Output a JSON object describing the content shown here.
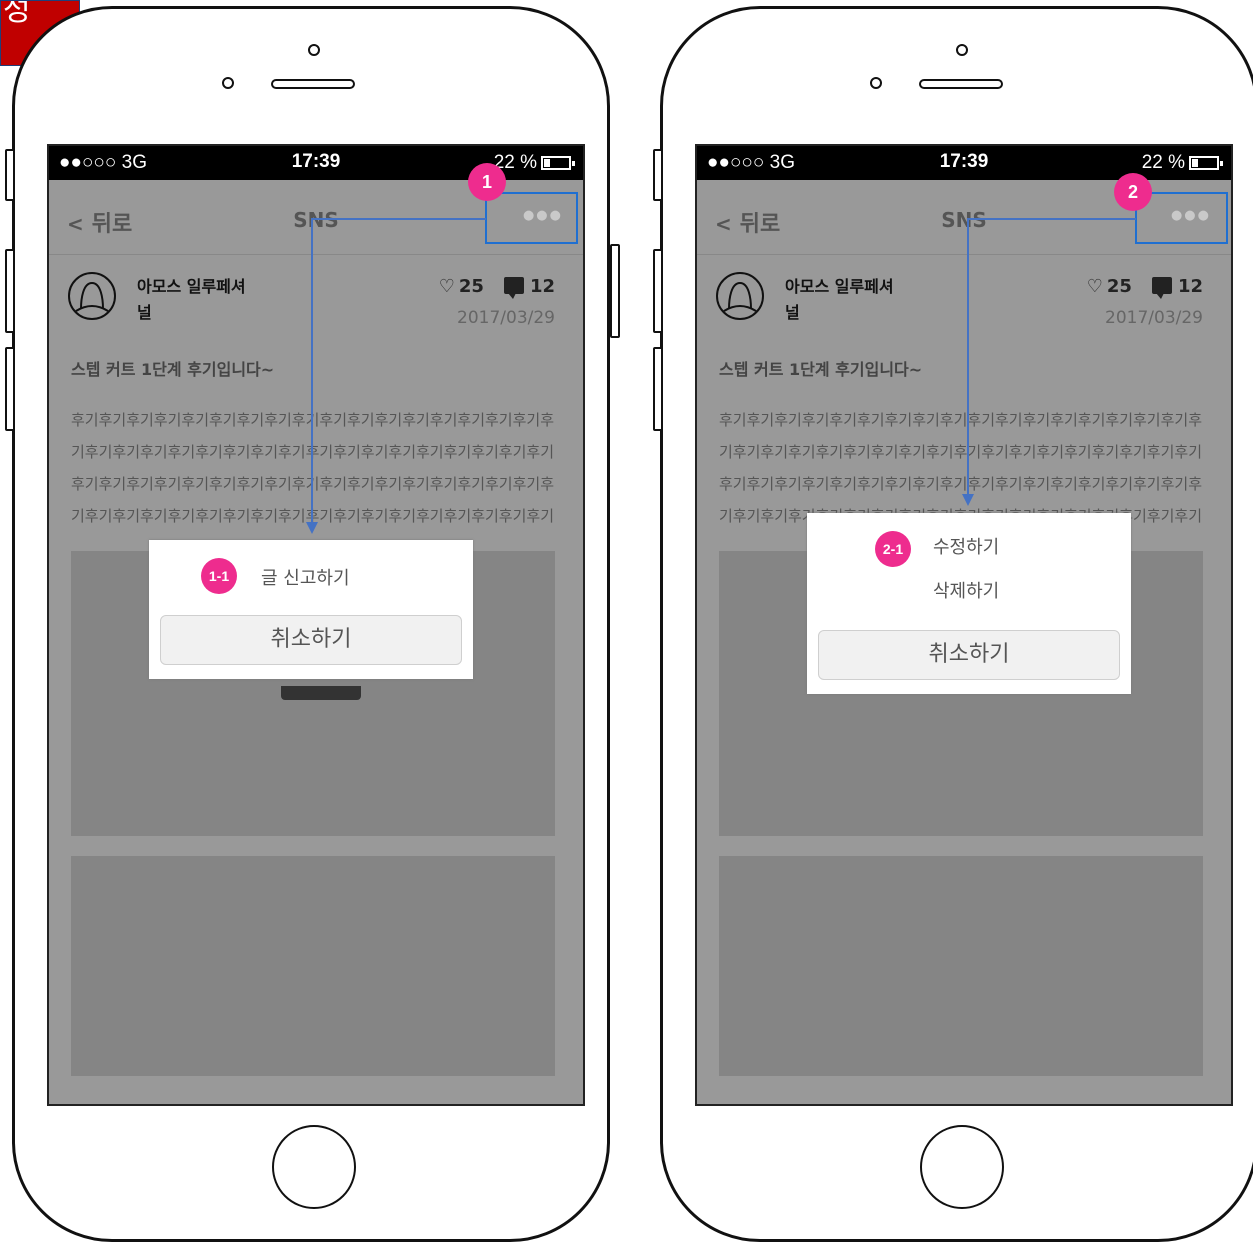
{
  "corner_label": "성",
  "status_bar": {
    "signal": "●●○○○  3G",
    "time": "17:39",
    "battery": "22 %"
  },
  "nav": {
    "back_arrow": "<",
    "back_label": "뒤로",
    "title": "SNS",
    "more_icon": "●●●"
  },
  "post": {
    "username": "아모스 일루페셔널",
    "likes": "25",
    "comments": "12",
    "date": "2017/03/29",
    "title": "스텝 커트 1단계 후기입니다~",
    "body": "후기후기후기후기후기후기후기후기후기후기후기후기후기후기후기후기후기후기후기후기후기후기후기후기후기후기후기후기후기후기후기후기후기후기후기후기후기후기후기후기후기후기후기후기후기후기후기후기후기후기후기후기후기후기후기후기후기후기후기후기후기후기후기후기후기후기후기후기후기후기후기후기"
  },
  "phone_left": {
    "badge": "1",
    "dialog_badge": "1-1",
    "option_report": "글 신고하기",
    "cancel": "취소하기"
  },
  "phone_right": {
    "badge": "2",
    "dialog_badge": "2-1",
    "option_edit": "수정하기",
    "option_delete": "삭제하기",
    "cancel": "취소하기"
  },
  "colors": {
    "badge": "#ee2c8e",
    "highlight": "#1f6fd1",
    "connector": "#4472c4",
    "corner_tag": "#c00000"
  }
}
